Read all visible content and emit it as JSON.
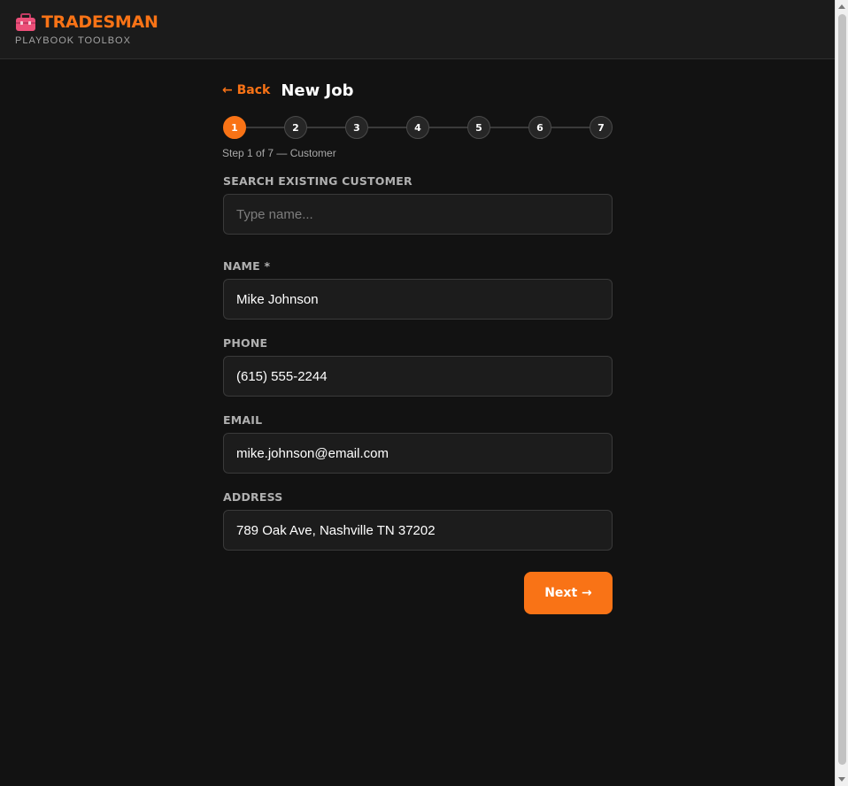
{
  "brand": {
    "name": "TRADESMAN",
    "subtitle": "PLAYBOOK TOOLBOX",
    "icon": "toolbox-icon",
    "accent_color": "#f97316",
    "icon_color": "#ec4f79"
  },
  "header": {
    "back_label": "← Back",
    "title": "New Job"
  },
  "stepper": {
    "steps": [
      "1",
      "2",
      "3",
      "4",
      "5",
      "6",
      "7"
    ],
    "current_step": 1,
    "caption": "Step 1 of 7 — Customer"
  },
  "form": {
    "search": {
      "label": "SEARCH EXISTING CUSTOMER",
      "value": "",
      "placeholder": "Type name..."
    },
    "name": {
      "label": "NAME *",
      "value": "Mike Johnson",
      "placeholder": ""
    },
    "phone": {
      "label": "PHONE",
      "value": "(615) 555-2244",
      "placeholder": ""
    },
    "email": {
      "label": "EMAIL",
      "value": "mike.johnson@email.com",
      "placeholder": ""
    },
    "address": {
      "label": "ADDRESS",
      "value": "789 Oak Ave, Nashville TN 37202",
      "placeholder": ""
    }
  },
  "actions": {
    "next_label": "Next →"
  }
}
